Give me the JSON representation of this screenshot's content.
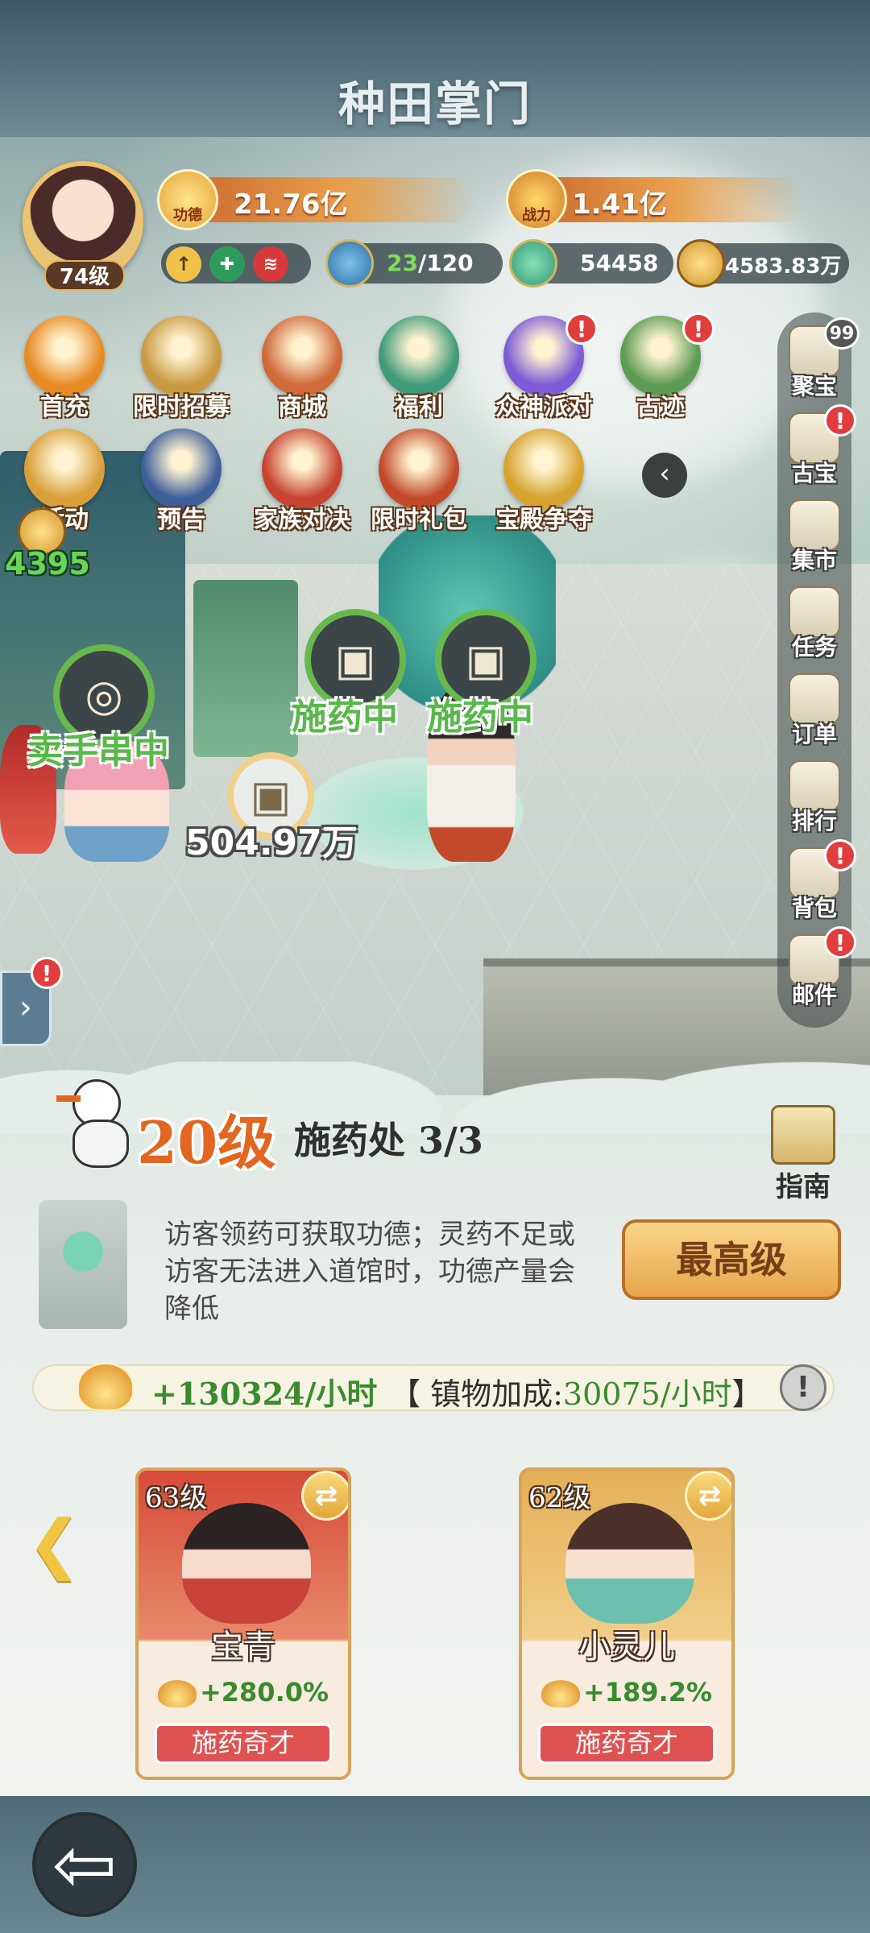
{
  "game": {
    "logo": "种田掌门"
  },
  "player": {
    "level": "74级",
    "merit_label": "功德",
    "merit_value": "21.76亿",
    "power_label": "战力",
    "power_value": "1.41亿",
    "stamina": "23",
    "stamina_max": "/120",
    "jade": "54458",
    "coins": "4583.83万"
  },
  "activities": [
    {
      "label": "首充",
      "icon": "first-charge-icon",
      "color": "#e88b25"
    },
    {
      "label": "限时招募",
      "icon": "recruit-icon",
      "color": "#c99a42"
    },
    {
      "label": "商城",
      "icon": "shop-icon",
      "color": "#d06a3a"
    },
    {
      "label": "福利",
      "icon": "gift-box-icon",
      "color": "#3f9b7a"
    },
    {
      "label": "众神派对",
      "icon": "party-star-icon",
      "color": "#7b5bd6",
      "badge": "!"
    },
    {
      "label": "古迹",
      "icon": "relic-icon",
      "color": "#5c9b53",
      "badge": "!"
    },
    {
      "label": "活动",
      "icon": "drum-icon",
      "color": "#d9a03a"
    },
    {
      "label": "预告",
      "icon": "preview-icon",
      "color": "#3f5f9b"
    },
    {
      "label": "家族对决",
      "icon": "clan-battle-icon",
      "color": "#c74431"
    },
    {
      "label": "限时礼包",
      "icon": "gift-bag-icon",
      "color": "#c24a2a"
    },
    {
      "label": "宝殿争夺",
      "icon": "palace-icon",
      "color": "#d7a32f"
    }
  ],
  "sidebar": [
    {
      "label": "聚宝",
      "icon": "treasure-icon",
      "badge": "99"
    },
    {
      "label": "古宝",
      "icon": "antique-icon",
      "badge": "!"
    },
    {
      "label": "集市",
      "icon": "market-icon"
    },
    {
      "label": "任务",
      "icon": "scroll-icon"
    },
    {
      "label": "订单",
      "icon": "order-icon"
    },
    {
      "label": "排行",
      "icon": "ranking-icon"
    },
    {
      "label": "背包",
      "icon": "bag-icon",
      "badge": "!"
    },
    {
      "label": "邮件",
      "icon": "mail-icon",
      "badge": "!"
    }
  ],
  "scene": {
    "left_count": "4395",
    "status_1": "卖手串中",
    "status_2": "施药中",
    "status_3": "施药中",
    "collect_amount": "504.97万",
    "left_panel_badge": "!"
  },
  "building": {
    "level": "20级",
    "name": "施药处 3/3",
    "guide_label": "指南",
    "description": "访客领药可获取功德；灵药不足或访客无法进入道馆时，功德产量会降低",
    "max_button": "最高级",
    "yield_main": "+130324/小时",
    "bonus_prefix": "【 镇物加成:",
    "bonus_value": "30075/小时",
    "bonus_suffix": "】"
  },
  "workers": [
    {
      "level": "63级",
      "name": "宝青",
      "bonus": "+280.0%",
      "trait": "施药奇才",
      "theme": "red"
    },
    {
      "level": "62级",
      "name": "小灵儿",
      "bonus": "+189.2%",
      "trait": "施药奇才",
      "theme": "gold"
    }
  ]
}
